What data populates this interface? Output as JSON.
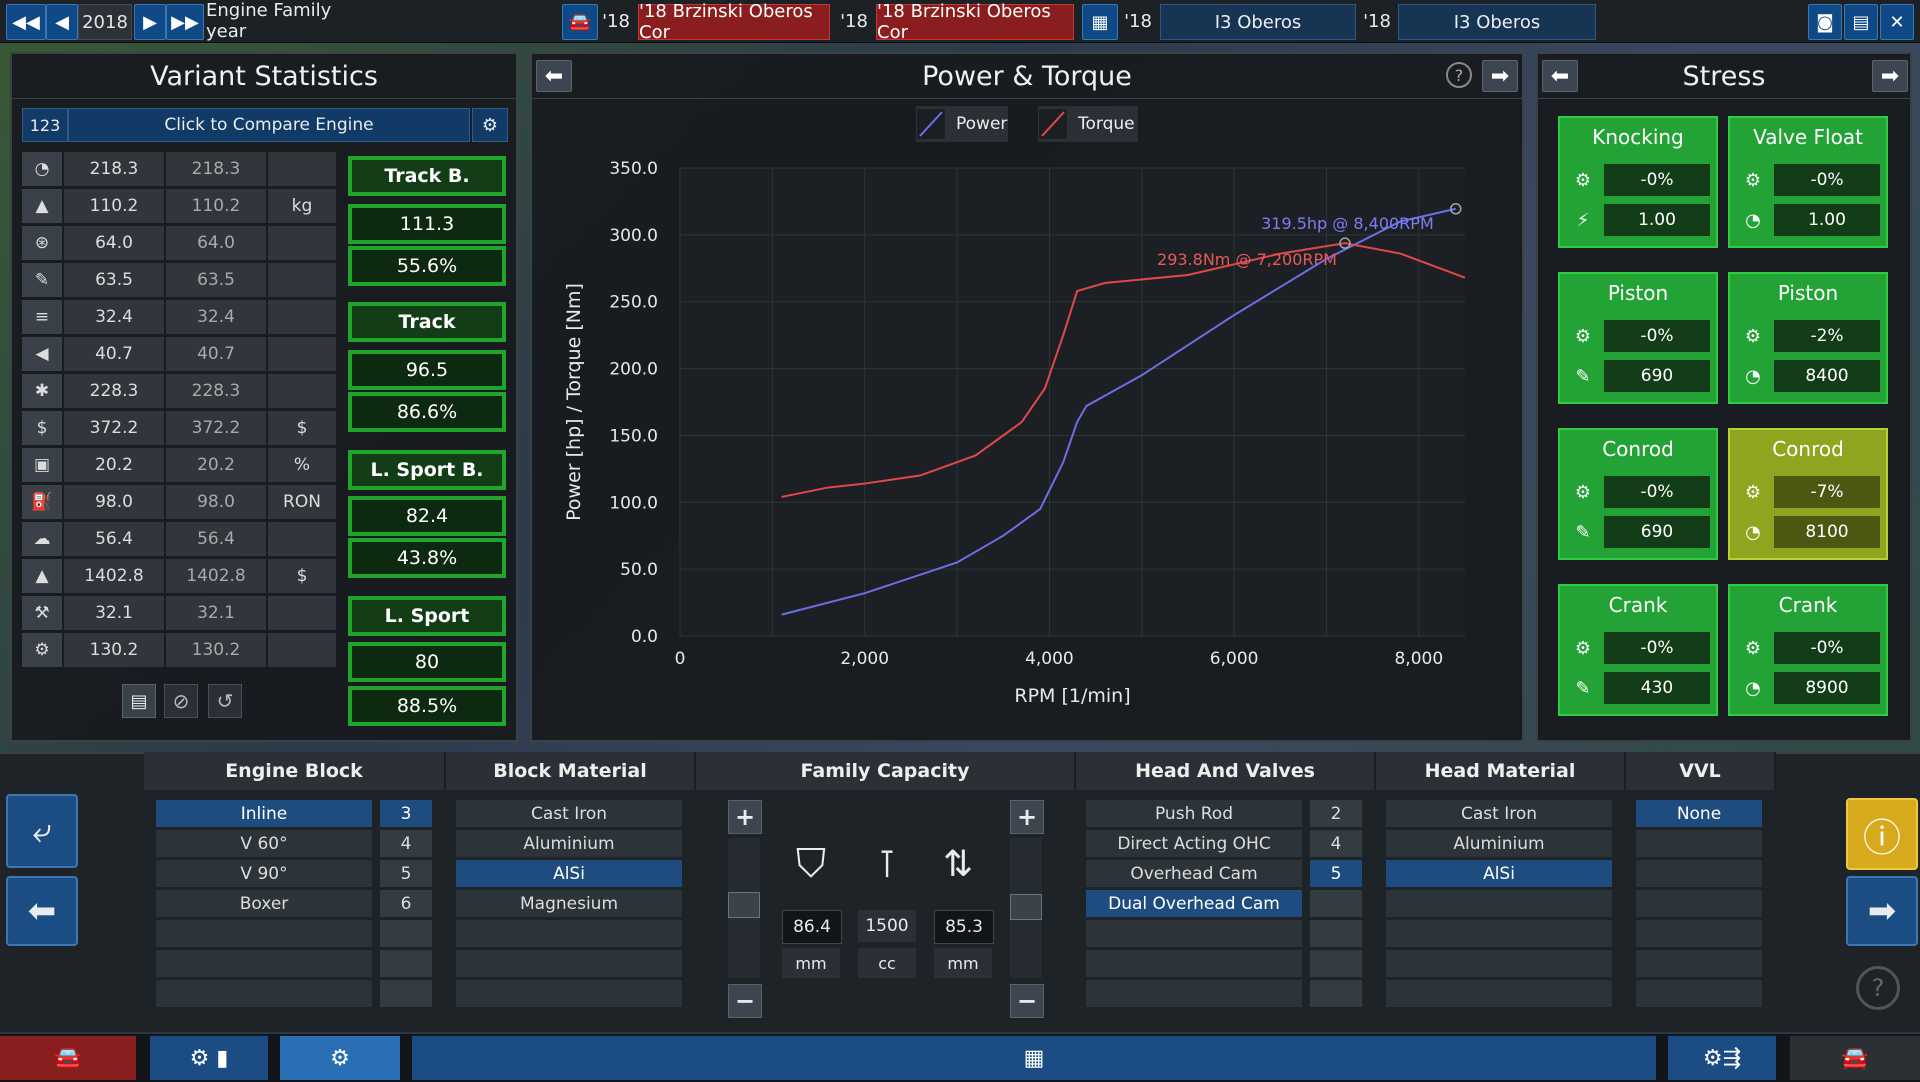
{
  "topbar": {
    "year": "2018",
    "title": "Engine Family year",
    "tabs": [
      {
        "year": "'18",
        "name": "'18 Brzinski Oberos Cor"
      },
      {
        "year": "'18",
        "name": "'18 Brzinski Oberos Cor"
      },
      {
        "year": "'18",
        "name": "I3 Oberos"
      },
      {
        "year": "'18",
        "name": "I3 Oberos"
      }
    ]
  },
  "variant_stats": {
    "title": "Variant Statistics",
    "compare_badge": "123",
    "compare_label": "Click to Compare Engine",
    "rows": [
      {
        "icon": "gauge-icon",
        "a": "218.3",
        "b": "218.3",
        "unit": ""
      },
      {
        "icon": "weight-icon",
        "a": "110.2",
        "b": "110.2",
        "unit": "kg"
      },
      {
        "icon": "torque-icon",
        "a": "64.0",
        "b": "64.0",
        "unit": ""
      },
      {
        "icon": "wrench-icon",
        "a": "63.5",
        "b": "63.5",
        "unit": ""
      },
      {
        "icon": "radiator-icon",
        "a": "32.4",
        "b": "32.4",
        "unit": ""
      },
      {
        "icon": "speaker-icon",
        "a": "40.7",
        "b": "40.7",
        "unit": ""
      },
      {
        "icon": "snowflake-icon",
        "a": "228.3",
        "b": "228.3",
        "unit": ""
      },
      {
        "icon": "cost-icon",
        "a": "372.2",
        "b": "372.2",
        "unit": "$"
      },
      {
        "icon": "fuel-can-icon",
        "a": "20.2",
        "b": "20.2",
        "unit": "%"
      },
      {
        "icon": "fuel-pump-icon",
        "a": "98.0",
        "b": "98.0",
        "unit": "RON"
      },
      {
        "icon": "emissions-icon",
        "a": "56.4",
        "b": "56.4",
        "unit": ""
      },
      {
        "icon": "price-icon",
        "a": "1402.8",
        "b": "1402.8",
        "unit": "$"
      },
      {
        "icon": "service-icon",
        "a": "32.1",
        "b": "32.1",
        "unit": ""
      },
      {
        "icon": "gear-icon",
        "a": "130.2",
        "b": "130.2",
        "unit": ""
      }
    ],
    "scores": [
      {
        "title": "Track B.",
        "value": "111.3",
        "pct": "55.6%"
      },
      {
        "title": "Track",
        "value": "96.5",
        "pct": "86.6%"
      },
      {
        "title": "L. Sport B.",
        "value": "82.4",
        "pct": "43.8%"
      },
      {
        "title": "L. Sport",
        "value": "80",
        "pct": "88.5%"
      }
    ]
  },
  "power_torque": {
    "title": "Power & Torque",
    "legend": {
      "power": "Power",
      "torque": "Torque"
    },
    "power_peak": "319.5hp @ 8,400RPM",
    "torque_peak": "293.8Nm @ 7,200RPM",
    "colors": {
      "power": "#6c6ee6",
      "torque": "#e0484a"
    }
  },
  "chart_data": {
    "type": "line",
    "xlabel": "RPM [1/min]",
    "ylabel": "Power [hp] / Torque [Nm]",
    "xlim": [
      0,
      8500
    ],
    "ylim": [
      0,
      350
    ],
    "x_ticks": [
      "0",
      "2,000",
      "4,000",
      "6,000",
      "8,000"
    ],
    "y_ticks": [
      "0.0",
      "50.0",
      "100.0",
      "150.0",
      "200.0",
      "250.0",
      "300.0",
      "350.0"
    ],
    "series": [
      {
        "name": "Power",
        "x": [
          1100,
          2000,
          3000,
          3500,
          3900,
          4150,
          4300,
          4400,
          5000,
          6000,
          7000,
          7800,
          8400
        ],
        "y": [
          16,
          32,
          55,
          75,
          95,
          130,
          160,
          172,
          195,
          240,
          282,
          310,
          319.5
        ]
      },
      {
        "name": "Torque",
        "x": [
          1100,
          1600,
          2000,
          2600,
          3200,
          3700,
          3950,
          4150,
          4300,
          4600,
          5500,
          6500,
          7200,
          7800,
          8500
        ],
        "y": [
          104,
          111,
          114,
          120,
          135,
          160,
          185,
          225,
          258,
          264,
          270,
          286,
          293.8,
          286,
          268
        ]
      }
    ]
  },
  "stress": {
    "title": "Stress",
    "cards": [
      {
        "title": "Knocking",
        "v1": "-0%",
        "v2": "1.00",
        "icon2": "knock-icon",
        "warn": false
      },
      {
        "title": "Valve Float",
        "v1": "-0%",
        "v2": "1.00",
        "icon2": "tachometer-icon",
        "warn": false
      },
      {
        "title": "Piston",
        "v1": "-0%",
        "v2": "690",
        "icon2": "wrench-icon",
        "warn": false
      },
      {
        "title": "Piston",
        "v1": "-2%",
        "v2": "8400",
        "icon2": "tachometer-icon",
        "warn": false
      },
      {
        "title": "Conrod",
        "v1": "-0%",
        "v2": "690",
        "icon2": "wrench-icon",
        "warn": false
      },
      {
        "title": "Conrod",
        "v1": "-7%",
        "v2": "8100",
        "icon2": "tachometer-icon",
        "warn": true
      },
      {
        "title": "Crank",
        "v1": "-0%",
        "v2": "430",
        "icon2": "wrench-icon",
        "warn": false
      },
      {
        "title": "Crank",
        "v1": "-0%",
        "v2": "8900",
        "icon2": "tachometer-icon",
        "warn": false
      }
    ]
  },
  "engine_block": {
    "title": "Engine Block",
    "types": [
      "Inline",
      "V 60°",
      "V 90°",
      "Boxer"
    ],
    "cylinders": [
      "3",
      "4",
      "5",
      "6"
    ]
  },
  "block_material": {
    "title": "Block Material",
    "options": [
      "Cast Iron",
      "Aluminium",
      "AlSi",
      "Magnesium"
    ]
  },
  "family_capacity": {
    "title": "Family Capacity",
    "bore": "86.4",
    "bore_unit": "mm",
    "capacity": "1500",
    "capacity_unit": "cc",
    "stroke": "85.3",
    "stroke_unit": "mm"
  },
  "head_valves": {
    "title": "Head And Valves",
    "options": [
      "Push Rod",
      "Direct Acting OHC",
      "Overhead Cam",
      "Dual Overhead Cam"
    ],
    "valves": [
      "2",
      "4",
      "5"
    ]
  },
  "head_material": {
    "title": "Head Material",
    "options": [
      "Cast Iron",
      "Aluminium",
      "AlSi"
    ]
  },
  "vvl": {
    "title": "VVL",
    "options": [
      "None"
    ]
  }
}
